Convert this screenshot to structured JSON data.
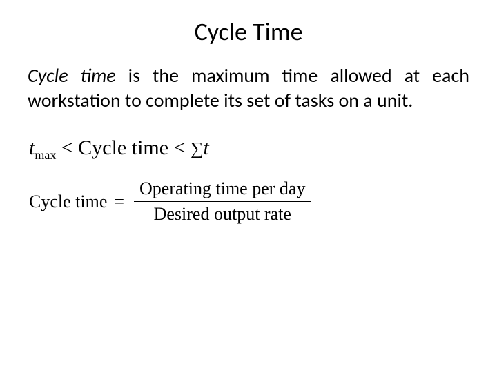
{
  "title": "Cycle Time",
  "definition": {
    "term": "Cycle time",
    "rest": " is the maximum time allowed at each workstation to complete its set of tasks on a unit."
  },
  "inequality": {
    "t": "t",
    "max": "max",
    "lt1": " <  ",
    "ct": "Cycle time",
    "lt2": "  < ",
    "sum": "∑",
    "t2": "t"
  },
  "formula": {
    "lhs": "Cycle time",
    "eq": "=",
    "numerator": "Operating time per day",
    "denominator": "Desired output rate"
  }
}
